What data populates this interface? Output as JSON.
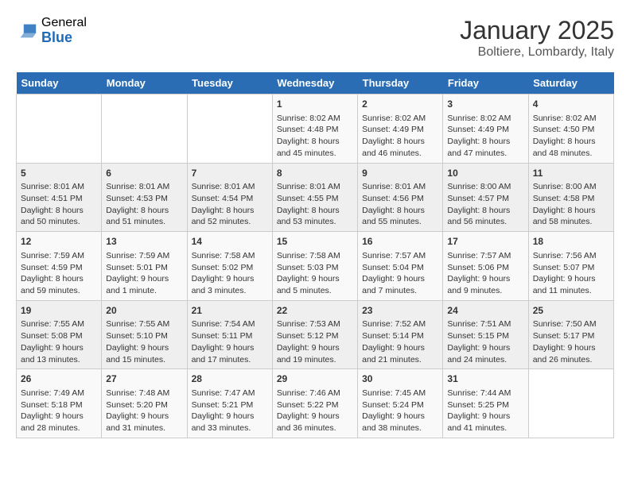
{
  "header": {
    "logo_general": "General",
    "logo_blue": "Blue",
    "title": "January 2025",
    "subtitle": "Boltiere, Lombardy, Italy"
  },
  "days_of_week": [
    "Sunday",
    "Monday",
    "Tuesday",
    "Wednesday",
    "Thursday",
    "Friday",
    "Saturday"
  ],
  "weeks": [
    [
      {
        "day": "",
        "content": ""
      },
      {
        "day": "",
        "content": ""
      },
      {
        "day": "",
        "content": ""
      },
      {
        "day": "1",
        "content": "Sunrise: 8:02 AM\nSunset: 4:48 PM\nDaylight: 8 hours and 45 minutes."
      },
      {
        "day": "2",
        "content": "Sunrise: 8:02 AM\nSunset: 4:49 PM\nDaylight: 8 hours and 46 minutes."
      },
      {
        "day": "3",
        "content": "Sunrise: 8:02 AM\nSunset: 4:49 PM\nDaylight: 8 hours and 47 minutes."
      },
      {
        "day": "4",
        "content": "Sunrise: 8:02 AM\nSunset: 4:50 PM\nDaylight: 8 hours and 48 minutes."
      }
    ],
    [
      {
        "day": "5",
        "content": "Sunrise: 8:01 AM\nSunset: 4:51 PM\nDaylight: 8 hours and 50 minutes."
      },
      {
        "day": "6",
        "content": "Sunrise: 8:01 AM\nSunset: 4:53 PM\nDaylight: 8 hours and 51 minutes."
      },
      {
        "day": "7",
        "content": "Sunrise: 8:01 AM\nSunset: 4:54 PM\nDaylight: 8 hours and 52 minutes."
      },
      {
        "day": "8",
        "content": "Sunrise: 8:01 AM\nSunset: 4:55 PM\nDaylight: 8 hours and 53 minutes."
      },
      {
        "day": "9",
        "content": "Sunrise: 8:01 AM\nSunset: 4:56 PM\nDaylight: 8 hours and 55 minutes."
      },
      {
        "day": "10",
        "content": "Sunrise: 8:00 AM\nSunset: 4:57 PM\nDaylight: 8 hours and 56 minutes."
      },
      {
        "day": "11",
        "content": "Sunrise: 8:00 AM\nSunset: 4:58 PM\nDaylight: 8 hours and 58 minutes."
      }
    ],
    [
      {
        "day": "12",
        "content": "Sunrise: 7:59 AM\nSunset: 4:59 PM\nDaylight: 8 hours and 59 minutes."
      },
      {
        "day": "13",
        "content": "Sunrise: 7:59 AM\nSunset: 5:01 PM\nDaylight: 9 hours and 1 minute."
      },
      {
        "day": "14",
        "content": "Sunrise: 7:58 AM\nSunset: 5:02 PM\nDaylight: 9 hours and 3 minutes."
      },
      {
        "day": "15",
        "content": "Sunrise: 7:58 AM\nSunset: 5:03 PM\nDaylight: 9 hours and 5 minutes."
      },
      {
        "day": "16",
        "content": "Sunrise: 7:57 AM\nSunset: 5:04 PM\nDaylight: 9 hours and 7 minutes."
      },
      {
        "day": "17",
        "content": "Sunrise: 7:57 AM\nSunset: 5:06 PM\nDaylight: 9 hours and 9 minutes."
      },
      {
        "day": "18",
        "content": "Sunrise: 7:56 AM\nSunset: 5:07 PM\nDaylight: 9 hours and 11 minutes."
      }
    ],
    [
      {
        "day": "19",
        "content": "Sunrise: 7:55 AM\nSunset: 5:08 PM\nDaylight: 9 hours and 13 minutes."
      },
      {
        "day": "20",
        "content": "Sunrise: 7:55 AM\nSunset: 5:10 PM\nDaylight: 9 hours and 15 minutes."
      },
      {
        "day": "21",
        "content": "Sunrise: 7:54 AM\nSunset: 5:11 PM\nDaylight: 9 hours and 17 minutes."
      },
      {
        "day": "22",
        "content": "Sunrise: 7:53 AM\nSunset: 5:12 PM\nDaylight: 9 hours and 19 minutes."
      },
      {
        "day": "23",
        "content": "Sunrise: 7:52 AM\nSunset: 5:14 PM\nDaylight: 9 hours and 21 minutes."
      },
      {
        "day": "24",
        "content": "Sunrise: 7:51 AM\nSunset: 5:15 PM\nDaylight: 9 hours and 24 minutes."
      },
      {
        "day": "25",
        "content": "Sunrise: 7:50 AM\nSunset: 5:17 PM\nDaylight: 9 hours and 26 minutes."
      }
    ],
    [
      {
        "day": "26",
        "content": "Sunrise: 7:49 AM\nSunset: 5:18 PM\nDaylight: 9 hours and 28 minutes."
      },
      {
        "day": "27",
        "content": "Sunrise: 7:48 AM\nSunset: 5:20 PM\nDaylight: 9 hours and 31 minutes."
      },
      {
        "day": "28",
        "content": "Sunrise: 7:47 AM\nSunset: 5:21 PM\nDaylight: 9 hours and 33 minutes."
      },
      {
        "day": "29",
        "content": "Sunrise: 7:46 AM\nSunset: 5:22 PM\nDaylight: 9 hours and 36 minutes."
      },
      {
        "day": "30",
        "content": "Sunrise: 7:45 AM\nSunset: 5:24 PM\nDaylight: 9 hours and 38 minutes."
      },
      {
        "day": "31",
        "content": "Sunrise: 7:44 AM\nSunset: 5:25 PM\nDaylight: 9 hours and 41 minutes."
      },
      {
        "day": "",
        "content": ""
      }
    ]
  ]
}
